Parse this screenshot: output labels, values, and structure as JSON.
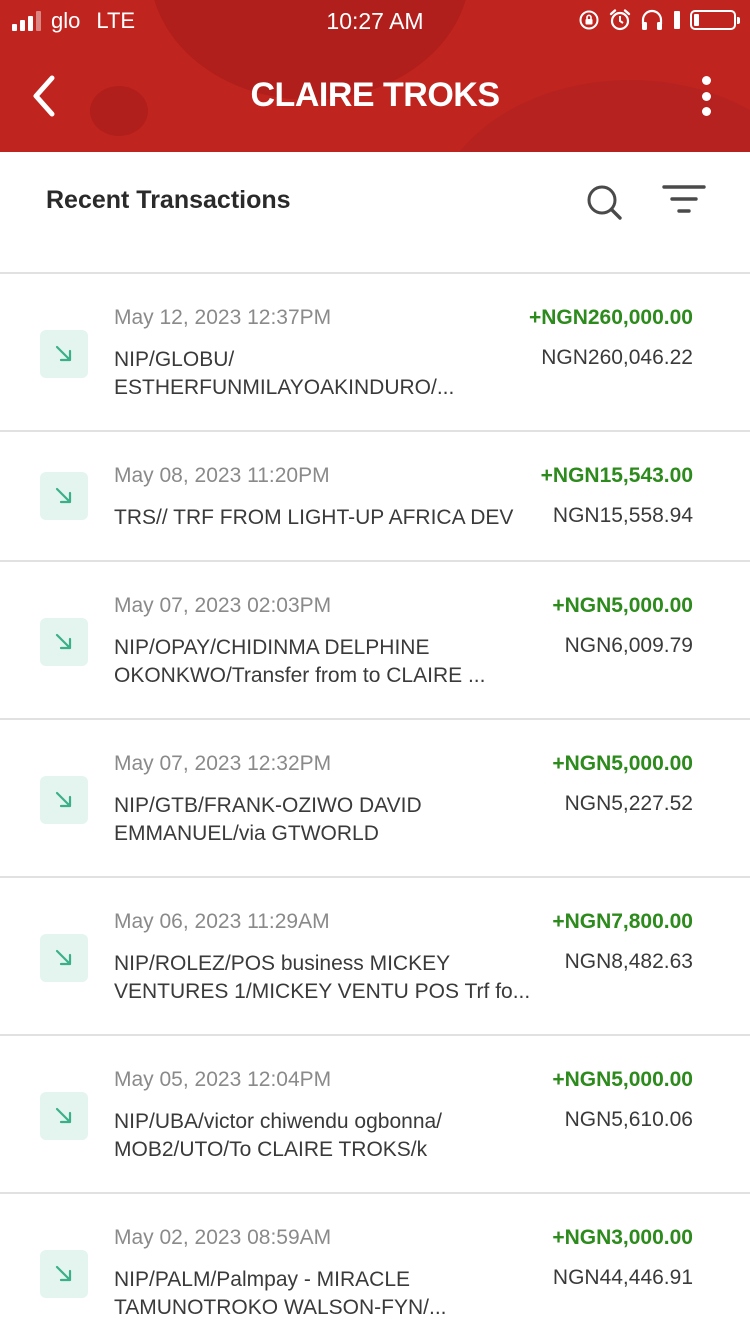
{
  "status_bar": {
    "carrier": "glo",
    "network": "LTE",
    "time": "10:27 AM"
  },
  "header": {
    "title": "CLAIRE TROKS"
  },
  "section": {
    "title": "Recent Transactions"
  },
  "colors": {
    "header_bg": "#c0241f",
    "credit_amount": "#2d8a1c",
    "icon_bg": "#e3f5ee",
    "icon_arrow": "#3bb088"
  },
  "transactions": [
    {
      "date": "May 12, 2023 12:37PM",
      "description": "NIP/GLOBU/\nESTHERFUNMILAYOAKINDURO/...",
      "amount": "+NGN260,000.00",
      "balance": "NGN260,046.22",
      "icon": "incoming-arrow-icon"
    },
    {
      "date": "May 08, 2023 11:20PM",
      "description": "TRS// TRF FROM LIGHT-UP AFRICA DEV",
      "amount": "+NGN15,543.00",
      "balance": "NGN15,558.94",
      "icon": "incoming-arrow-icon"
    },
    {
      "date": "May 07, 2023 02:03PM",
      "description": "NIP/OPAY/CHIDINMA DELPHINE\nOKONKWO/Transfer from to CLAIRE ...",
      "amount": "+NGN5,000.00",
      "balance": "NGN6,009.79",
      "icon": "incoming-arrow-icon"
    },
    {
      "date": "May 07, 2023 12:32PM",
      "description": "NIP/GTB/FRANK-OZIWO DAVID\nEMMANUEL/via GTWORLD",
      "amount": "+NGN5,000.00",
      "balance": "NGN5,227.52",
      "icon": "incoming-arrow-icon"
    },
    {
      "date": "May 06, 2023 11:29AM",
      "description": "NIP/ROLEZ/POS business MICKEY\nVENTURES 1/MICKEY VENTU POS Trf fo...",
      "amount": "+NGN7,800.00",
      "balance": "NGN8,482.63",
      "icon": "incoming-arrow-icon"
    },
    {
      "date": "May 05, 2023 12:04PM",
      "description": "NIP/UBA/victor chiwendu ogbonna/\nMOB2/UTO/To CLAIRE TROKS/k",
      "amount": "+NGN5,000.00",
      "balance": "NGN5,610.06",
      "icon": "incoming-arrow-icon"
    },
    {
      "date": "May 02, 2023 08:59AM",
      "description": "NIP/PALM/Palmpay - MIRACLE\nTAMUNOTROKO WALSON-FYN/...",
      "amount": "+NGN3,000.00",
      "balance": "NGN44,446.91",
      "icon": "incoming-arrow-icon"
    }
  ]
}
